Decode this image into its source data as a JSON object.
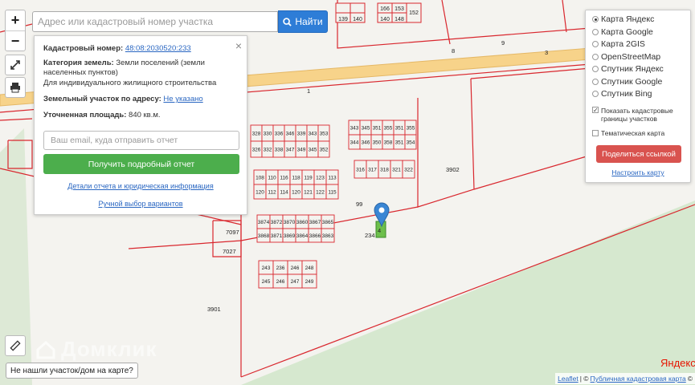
{
  "search": {
    "placeholder": "Адрес или кадастровый номер участка",
    "button_label": "Найти"
  },
  "zoom": {
    "in": "+",
    "out": "−"
  },
  "info_panel": {
    "cadastral_label": "Кадастровый номер:",
    "cadastral_value": "48:08:2030520:233",
    "category_label": "Категория земель:",
    "category_value": "Земли поселений (земли населенных пунктов)",
    "use_value": "Для индивидуального жилищного строительства",
    "address_label": "Земельный участок по адресу:",
    "address_value": "Не указано",
    "area_label": "Уточненная площадь:",
    "area_value": "840 кв.м.",
    "email_placeholder": "Ваш email, куда отправить отчет",
    "report_button": "Получить подробный отчет",
    "details_link": "Детали отчета и юридическая информация",
    "manual_link": "Ручной выбор вариантов",
    "close": "×"
  },
  "layers": {
    "options": [
      {
        "label": "Карта Яндекс",
        "selected": true
      },
      {
        "label": "Карта Google",
        "selected": false
      },
      {
        "label": "Карта 2GIS",
        "selected": false
      },
      {
        "label": "OpenStreetMap",
        "selected": false
      },
      {
        "label": "Спутник Яндекс",
        "selected": false
      },
      {
        "label": "Спутник Google",
        "selected": false
      },
      {
        "label": "Спутник Bing",
        "selected": false
      }
    ],
    "show_cadastral": "Показать кадастровые границы участков",
    "thematic": "Тематическая карта",
    "share_button": "Поделиться ссылкой",
    "setup_link": "Настроить карту"
  },
  "map": {
    "land_color": "#f4f3ef",
    "forest_color": "#d9ead3",
    "boundary_color": "#d9272e",
    "road_color": "#f6c96f",
    "selected_color": "#6dbf4b",
    "labels": {
      "l3901": "3901",
      "l3902": "3902",
      "l7097": "7097",
      "l7027": "7027",
      "l99": "99",
      "l8": "8",
      "l9": "9",
      "l3": "3",
      "l1": "1",
      "l234": "234",
      "l4": "4"
    },
    "row_a_top": [
      "328",
      "330",
      "336",
      "346",
      "339",
      "343",
      "353"
    ],
    "row_a_bot": [
      "326",
      "332",
      "338",
      "347",
      "349",
      "345",
      "352"
    ],
    "row_b_top": [
      "343",
      "345",
      "351",
      "355",
      "351",
      "355"
    ],
    "row_b_bot": [
      "344",
      "346",
      "350",
      "358",
      "351",
      "354"
    ],
    "row_c_top": [
      "108",
      "110",
      "116",
      "118",
      "119",
      "123",
      "113"
    ],
    "row_c_bot": [
      "120",
      "112",
      "114",
      "120",
      "121",
      "122",
      "115"
    ],
    "row_d": [
      "316",
      "317",
      "318",
      "321",
      "322"
    ],
    "row_e_top": [
      "3874",
      "3872",
      "3870",
      "3860",
      "3867",
      "3865"
    ],
    "row_e_bot": [
      "3868",
      "3871",
      "3869",
      "3864",
      "3866",
      "3863"
    ],
    "row_f_top": [
      "243",
      "236",
      "246",
      "248"
    ],
    "row_f_bot": [
      "245",
      "246",
      "247",
      "249"
    ],
    "top_blocks": [
      "139",
      "140",
      "166",
      "153",
      "140",
      "148",
      "152"
    ]
  },
  "ruler_icon": "ruler-icon",
  "not_found": "Не нашли участок/дом на карте?",
  "watermark": "Домклик",
  "yandex_logo": "Яндекс",
  "attribution": {
    "leaflet": "Leaflet",
    "separator": "| ©",
    "pkk": "Публичная кадастровая карта",
    "copy": "©"
  }
}
